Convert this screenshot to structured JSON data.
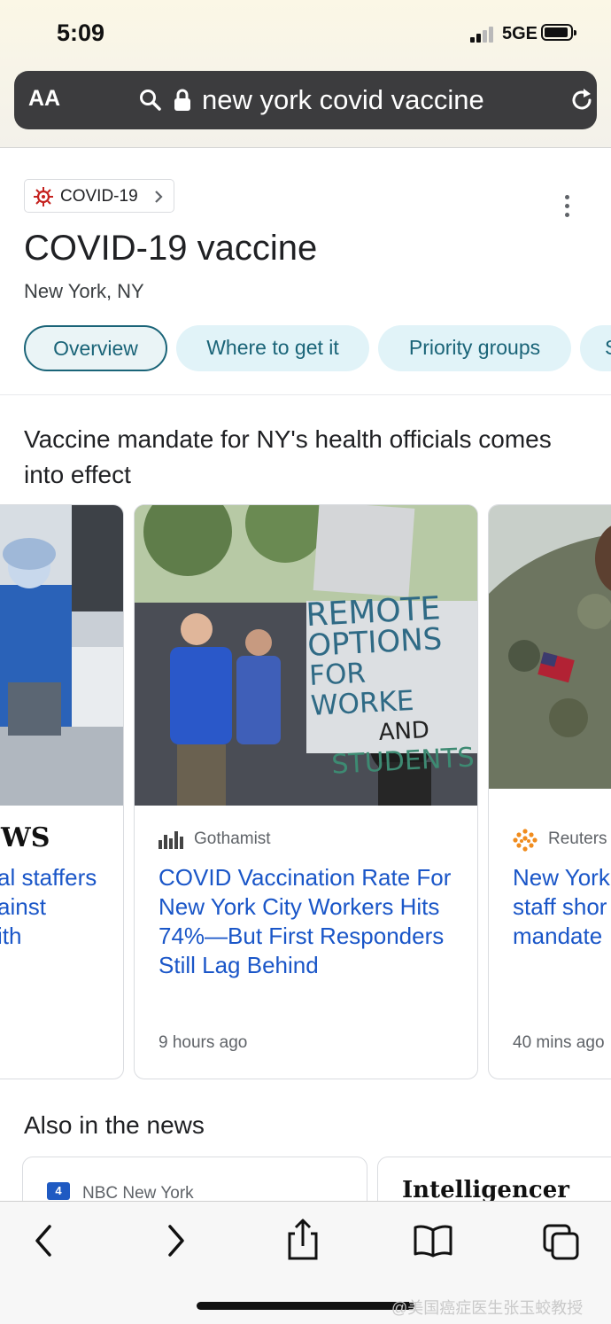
{
  "status_bar": {
    "time": "5:09",
    "network": "5GE"
  },
  "address_bar": {
    "aa_label": "AA",
    "url_text": "new york covid vaccine"
  },
  "topic_chip": {
    "label": "COVID-19"
  },
  "header": {
    "title": "COVID-19 vaccine",
    "location": "New York, NY"
  },
  "tabs": [
    {
      "label": "Overview",
      "active": true
    },
    {
      "label": "Where to get it",
      "active": false
    },
    {
      "label": "Priority groups",
      "active": false
    },
    {
      "label": "S",
      "active": false
    }
  ],
  "top_story": {
    "heading": "Vaccine mandate for NY's health officials comes into effect",
    "cards": [
      {
        "source": "WS",
        "title_lines": [
          "al staffers",
          "ainst",
          "ith"
        ],
        "time": ""
      },
      {
        "source": "Gothamist",
        "title_lines": [
          "COVID Vaccination Rate For",
          "New York City Workers Hits",
          "74%—But First Responders",
          "Still Lag Behind"
        ],
        "time": "9 hours ago"
      },
      {
        "source": "Reuters",
        "title_lines": [
          "New York",
          "staff shor",
          "mandate"
        ],
        "time": "40 mins ago"
      }
    ],
    "photo_sign_lines": [
      "REMOTE",
      "OPTIONS",
      "FOR WORKE",
      "AND",
      "STUDENTS"
    ]
  },
  "also_in_news": {
    "heading": "Also in the news",
    "items": [
      {
        "source": "NBC New York"
      },
      {
        "source": "Intelligencer"
      }
    ]
  },
  "watermark": "@美国癌症医生张玉蛟教授",
  "colors": {
    "link_blue": "#1a56c8",
    "chip_teal": "#1a6478",
    "tab_bg": "#e1f3f8"
  }
}
